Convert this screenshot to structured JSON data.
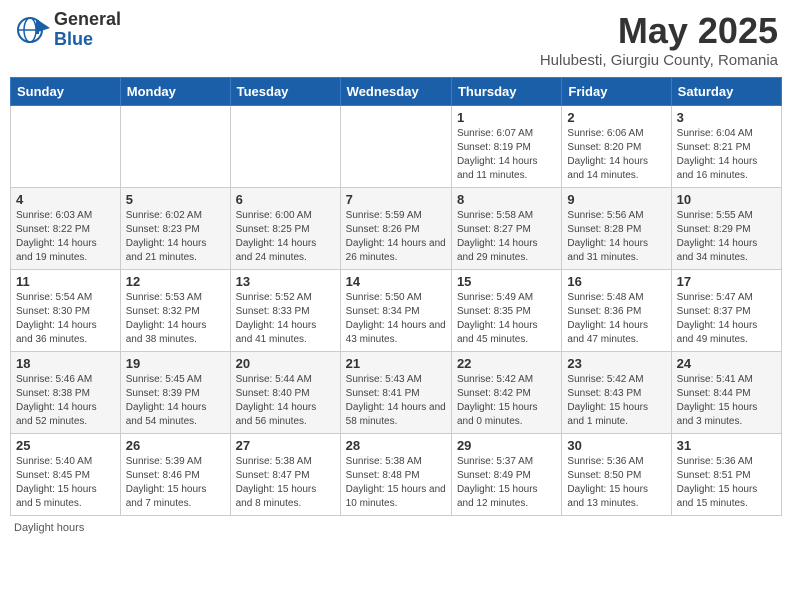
{
  "header": {
    "logo_general": "General",
    "logo_blue": "Blue",
    "month_title": "May 2025",
    "location": "Hulubesti, Giurgiu County, Romania"
  },
  "days_of_week": [
    "Sunday",
    "Monday",
    "Tuesday",
    "Wednesday",
    "Thursday",
    "Friday",
    "Saturday"
  ],
  "weeks": [
    [
      {
        "day": "",
        "detail": ""
      },
      {
        "day": "",
        "detail": ""
      },
      {
        "day": "",
        "detail": ""
      },
      {
        "day": "",
        "detail": ""
      },
      {
        "day": "1",
        "detail": "Sunrise: 6:07 AM\nSunset: 8:19 PM\nDaylight: 14 hours and 11 minutes."
      },
      {
        "day": "2",
        "detail": "Sunrise: 6:06 AM\nSunset: 8:20 PM\nDaylight: 14 hours and 14 minutes."
      },
      {
        "day": "3",
        "detail": "Sunrise: 6:04 AM\nSunset: 8:21 PM\nDaylight: 14 hours and 16 minutes."
      }
    ],
    [
      {
        "day": "4",
        "detail": "Sunrise: 6:03 AM\nSunset: 8:22 PM\nDaylight: 14 hours and 19 minutes."
      },
      {
        "day": "5",
        "detail": "Sunrise: 6:02 AM\nSunset: 8:23 PM\nDaylight: 14 hours and 21 minutes."
      },
      {
        "day": "6",
        "detail": "Sunrise: 6:00 AM\nSunset: 8:25 PM\nDaylight: 14 hours and 24 minutes."
      },
      {
        "day": "7",
        "detail": "Sunrise: 5:59 AM\nSunset: 8:26 PM\nDaylight: 14 hours and 26 minutes."
      },
      {
        "day": "8",
        "detail": "Sunrise: 5:58 AM\nSunset: 8:27 PM\nDaylight: 14 hours and 29 minutes."
      },
      {
        "day": "9",
        "detail": "Sunrise: 5:56 AM\nSunset: 8:28 PM\nDaylight: 14 hours and 31 minutes."
      },
      {
        "day": "10",
        "detail": "Sunrise: 5:55 AM\nSunset: 8:29 PM\nDaylight: 14 hours and 34 minutes."
      }
    ],
    [
      {
        "day": "11",
        "detail": "Sunrise: 5:54 AM\nSunset: 8:30 PM\nDaylight: 14 hours and 36 minutes."
      },
      {
        "day": "12",
        "detail": "Sunrise: 5:53 AM\nSunset: 8:32 PM\nDaylight: 14 hours and 38 minutes."
      },
      {
        "day": "13",
        "detail": "Sunrise: 5:52 AM\nSunset: 8:33 PM\nDaylight: 14 hours and 41 minutes."
      },
      {
        "day": "14",
        "detail": "Sunrise: 5:50 AM\nSunset: 8:34 PM\nDaylight: 14 hours and 43 minutes."
      },
      {
        "day": "15",
        "detail": "Sunrise: 5:49 AM\nSunset: 8:35 PM\nDaylight: 14 hours and 45 minutes."
      },
      {
        "day": "16",
        "detail": "Sunrise: 5:48 AM\nSunset: 8:36 PM\nDaylight: 14 hours and 47 minutes."
      },
      {
        "day": "17",
        "detail": "Sunrise: 5:47 AM\nSunset: 8:37 PM\nDaylight: 14 hours and 49 minutes."
      }
    ],
    [
      {
        "day": "18",
        "detail": "Sunrise: 5:46 AM\nSunset: 8:38 PM\nDaylight: 14 hours and 52 minutes."
      },
      {
        "day": "19",
        "detail": "Sunrise: 5:45 AM\nSunset: 8:39 PM\nDaylight: 14 hours and 54 minutes."
      },
      {
        "day": "20",
        "detail": "Sunrise: 5:44 AM\nSunset: 8:40 PM\nDaylight: 14 hours and 56 minutes."
      },
      {
        "day": "21",
        "detail": "Sunrise: 5:43 AM\nSunset: 8:41 PM\nDaylight: 14 hours and 58 minutes."
      },
      {
        "day": "22",
        "detail": "Sunrise: 5:42 AM\nSunset: 8:42 PM\nDaylight: 15 hours and 0 minutes."
      },
      {
        "day": "23",
        "detail": "Sunrise: 5:42 AM\nSunset: 8:43 PM\nDaylight: 15 hours and 1 minute."
      },
      {
        "day": "24",
        "detail": "Sunrise: 5:41 AM\nSunset: 8:44 PM\nDaylight: 15 hours and 3 minutes."
      }
    ],
    [
      {
        "day": "25",
        "detail": "Sunrise: 5:40 AM\nSunset: 8:45 PM\nDaylight: 15 hours and 5 minutes."
      },
      {
        "day": "26",
        "detail": "Sunrise: 5:39 AM\nSunset: 8:46 PM\nDaylight: 15 hours and 7 minutes."
      },
      {
        "day": "27",
        "detail": "Sunrise: 5:38 AM\nSunset: 8:47 PM\nDaylight: 15 hours and 8 minutes."
      },
      {
        "day": "28",
        "detail": "Sunrise: 5:38 AM\nSunset: 8:48 PM\nDaylight: 15 hours and 10 minutes."
      },
      {
        "day": "29",
        "detail": "Sunrise: 5:37 AM\nSunset: 8:49 PM\nDaylight: 15 hours and 12 minutes."
      },
      {
        "day": "30",
        "detail": "Sunrise: 5:36 AM\nSunset: 8:50 PM\nDaylight: 15 hours and 13 minutes."
      },
      {
        "day": "31",
        "detail": "Sunrise: 5:36 AM\nSunset: 8:51 PM\nDaylight: 15 hours and 15 minutes."
      }
    ]
  ],
  "footer": {
    "note": "Daylight hours"
  }
}
